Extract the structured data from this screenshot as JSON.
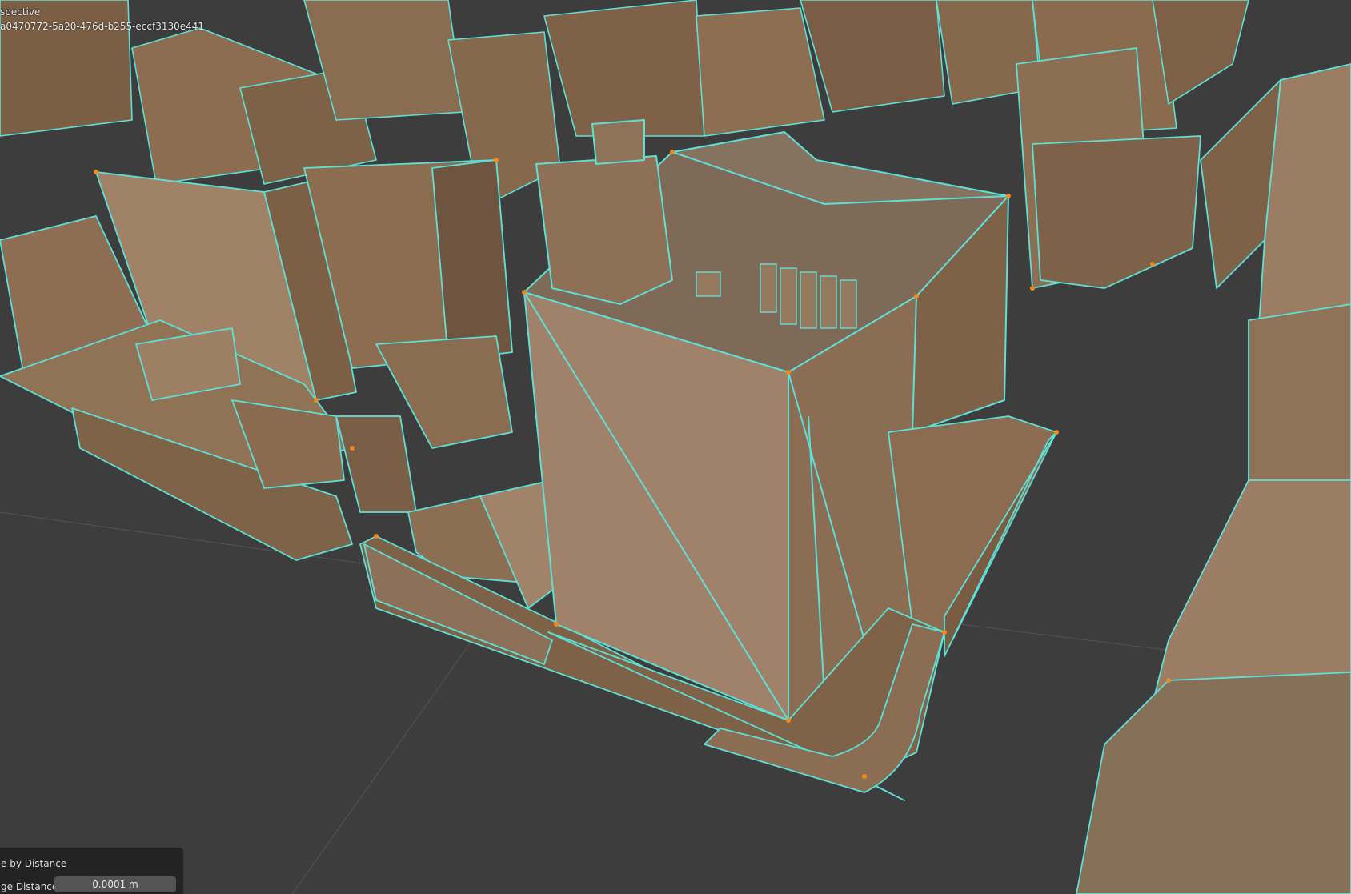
{
  "viewport": {
    "view_name": "spective",
    "object_name": "a0470772-5a20-476d-b255-eccf3130e441",
    "colors": {
      "background": "#3d3d3d",
      "edge_select": "#5ee0d8",
      "vertex_select": "#f08a1e",
      "facade": "#8a6a4a"
    }
  },
  "operator_panel": {
    "title": "e by Distance",
    "merge_distance_label": "ge Distance",
    "merge_distance_value": "0.0001 m"
  }
}
